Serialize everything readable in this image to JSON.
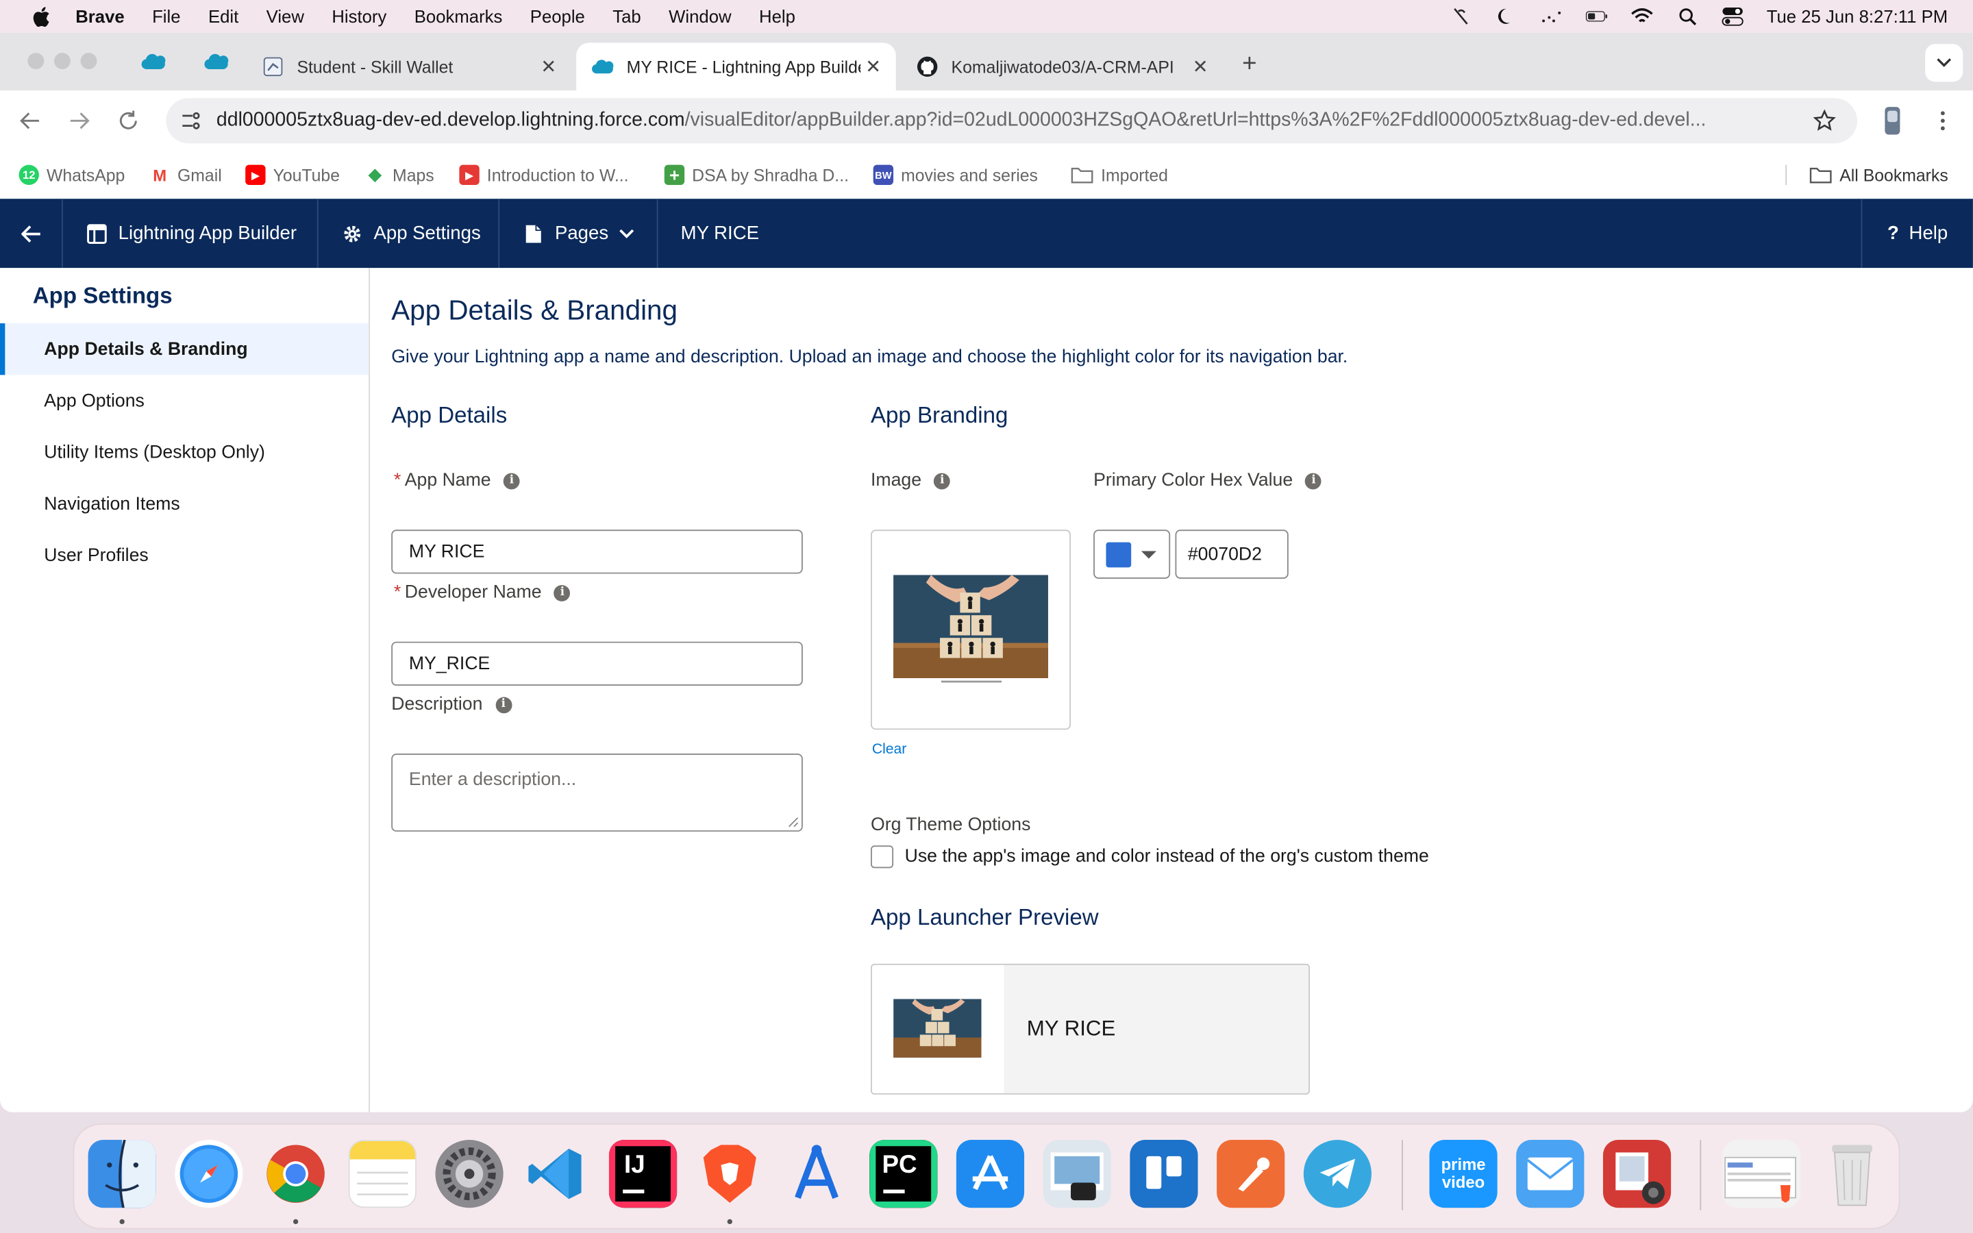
{
  "menubar": {
    "app_name": "Brave",
    "menus": [
      "File",
      "Edit",
      "View",
      "History",
      "Bookmarks",
      "People",
      "Tab",
      "Window",
      "Help"
    ],
    "clock": "Tue 25 Jun  8:27:11 PM"
  },
  "tabs": [
    {
      "title": "Student - Skill Wallet",
      "close": "✕"
    },
    {
      "title": "MY RICE - Lightning App Builder",
      "close": "✕"
    },
    {
      "title": "Komaljiwatode03/A-CRM-API",
      "close": "✕"
    }
  ],
  "new_tab_label": "+",
  "address": {
    "host": "ddl000005ztx8uag-dev-ed.develop.lightning.force.com",
    "path": "/visualEditor/appBuilder.app?id=02udL000003HZSgQAO&retUrl=https%3A%2F%2Fddl000005ztx8uag-dev-ed.devel..."
  },
  "bookmarks": [
    {
      "label": "WhatsApp",
      "color": "#25d366",
      "glyph": "12"
    },
    {
      "label": "Gmail",
      "color": "#ea4335",
      "glyph": "M"
    },
    {
      "label": "YouTube",
      "color": "#ff0000",
      "glyph": "▶"
    },
    {
      "label": "Maps",
      "color": "#34a853",
      "glyph": "◆"
    },
    {
      "label": "Introduction to W...",
      "color": "#e53935",
      "glyph": "▶"
    },
    {
      "label": "DSA by Shradha D...",
      "color": "#43a047",
      "glyph": "+"
    },
    {
      "label": "movies and series",
      "color": "#3f51b5",
      "glyph": "BW"
    },
    {
      "label": "Imported",
      "color": "",
      "glyph": ""
    }
  ],
  "all_bookmarks": "All Bookmarks",
  "sf_header": {
    "builder": "Lightning App Builder",
    "settings": "App Settings",
    "pages": "Pages",
    "app_name": "MY RICE",
    "help": "Help"
  },
  "sidebar": {
    "title": "App Settings",
    "items": [
      "App Details & Branding",
      "App Options",
      "Utility Items (Desktop Only)",
      "Navigation Items",
      "User Profiles"
    ]
  },
  "main": {
    "title": "App Details & Branding",
    "description": "Give your Lightning app a name and description. Upload an image and choose the highlight color for its navigation bar.",
    "details_heading": "App Details",
    "required_mark": "*",
    "app_name_label": "App Name",
    "app_name_value": "MY RICE",
    "dev_name_label": "Developer Name",
    "dev_name_value": "MY_RICE",
    "desc_label": "Description",
    "desc_placeholder": "Enter a description...",
    "branding_heading": "App Branding",
    "image_label": "Image",
    "clear_label": "Clear",
    "color_label": "Primary Color Hex Value",
    "color_hex": "#0070D2",
    "org_theme_label": "Org Theme Options",
    "org_theme_checkbox": "Use the app's image and color instead of the org's custom theme",
    "org_theme_checked": false,
    "preview_heading": "App Launcher Preview",
    "preview_name": "MY RICE"
  },
  "colors": {
    "sf_navy": "#0b2a5b",
    "brand_blue": "#0176d3",
    "swatch": "#2e6fd6"
  },
  "dock": [
    {
      "name": "finder",
      "bg": "#3b8ee6"
    },
    {
      "name": "safari",
      "bg": "#ffffff"
    },
    {
      "name": "chrome",
      "bg": "#ffffff"
    },
    {
      "name": "notes",
      "bg": "#fbe27a"
    },
    {
      "name": "system-settings",
      "bg": "#7d7d82"
    },
    {
      "name": "vscode",
      "bg": "#ffffff"
    },
    {
      "name": "intellij",
      "bg": "#1c1c1c"
    },
    {
      "name": "brave",
      "bg": "#ffffff"
    },
    {
      "name": "instruments",
      "bg": "#ffffff"
    },
    {
      "name": "pycharm",
      "bg": "#1c1c1c"
    },
    {
      "name": "app-store",
      "bg": "#1f8bf0"
    },
    {
      "name": "preview",
      "bg": "#dfe7ee"
    },
    {
      "name": "trello",
      "bg": "#1d72c9"
    },
    {
      "name": "postman",
      "bg": "#ef6c35"
    },
    {
      "name": "telegram",
      "bg": "#37a8df"
    },
    {
      "name": "prime-video",
      "bg": "#1a98ff"
    },
    {
      "name": "mail",
      "bg": "#4aa3f3"
    },
    {
      "name": "photo-booth",
      "bg": "#d33a35"
    },
    {
      "name": "downloads-stack",
      "bg": "#f2f2f2"
    },
    {
      "name": "trash",
      "bg": "#e7e7e7"
    }
  ],
  "dock_labels": {
    "intellij": "IJ",
    "pycharm": "PC",
    "prime": "prime video"
  }
}
